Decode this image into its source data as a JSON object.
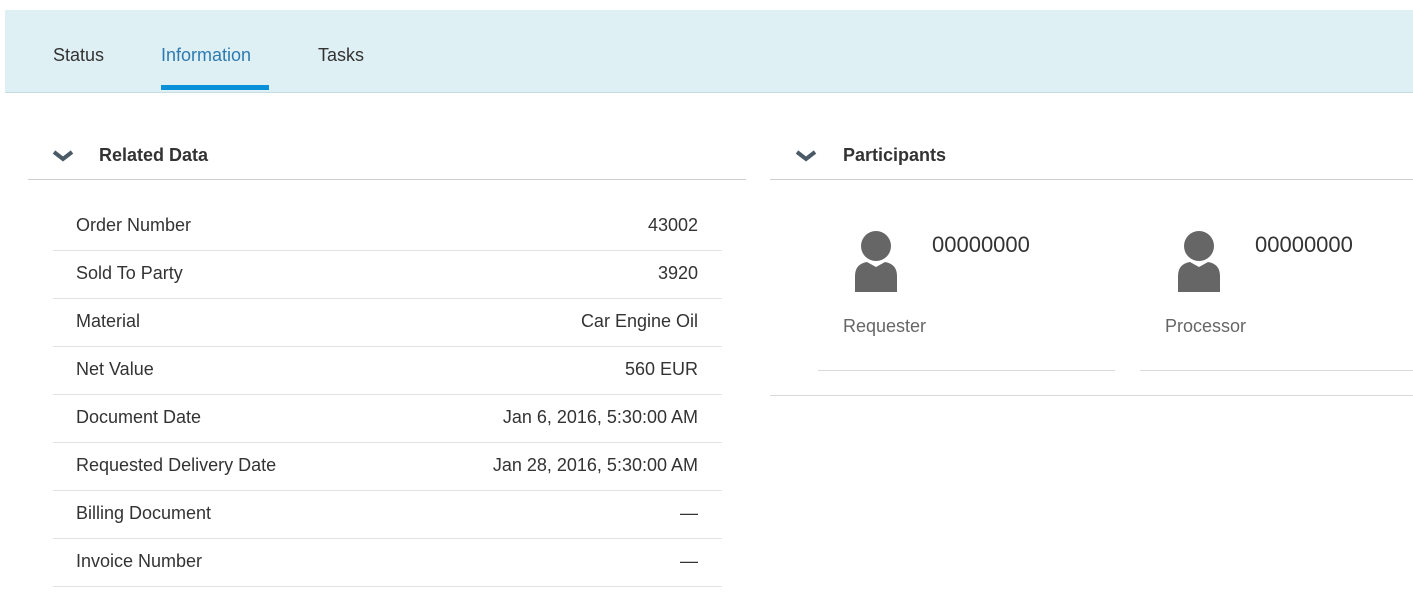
{
  "tabs": [
    {
      "label": "Status",
      "active": false
    },
    {
      "label": "Information",
      "active": true
    },
    {
      "label": "Tasks",
      "active": false
    }
  ],
  "related_data": {
    "title": "Related Data",
    "rows": [
      {
        "label": "Order Number",
        "value": "43002"
      },
      {
        "label": "Sold To Party",
        "value": "3920"
      },
      {
        "label": "Material",
        "value": "Car Engine Oil"
      },
      {
        "label": "Net Value",
        "value": "560 EUR"
      },
      {
        "label": "Document Date",
        "value": "Jan 6, 2016, 5:30:00 AM"
      },
      {
        "label": "Requested Delivery Date",
        "value": "Jan 28, 2016, 5:30:00 AM"
      },
      {
        "label": "Billing Document",
        "value": "—"
      },
      {
        "label": "Invoice Number",
        "value": "—"
      }
    ]
  },
  "participants": {
    "title": "Participants",
    "items": [
      {
        "id": "00000000",
        "role": "Requester",
        "icon": "person-icon"
      },
      {
        "id": "00000000",
        "role": "Processor",
        "icon": "person-icon"
      }
    ]
  },
  "colors": {
    "tabbar_bg": "#dff0f4",
    "active_tab_text": "#2d7bb0",
    "active_tab_underline": "#0a90d8",
    "avatar": "#666666"
  }
}
